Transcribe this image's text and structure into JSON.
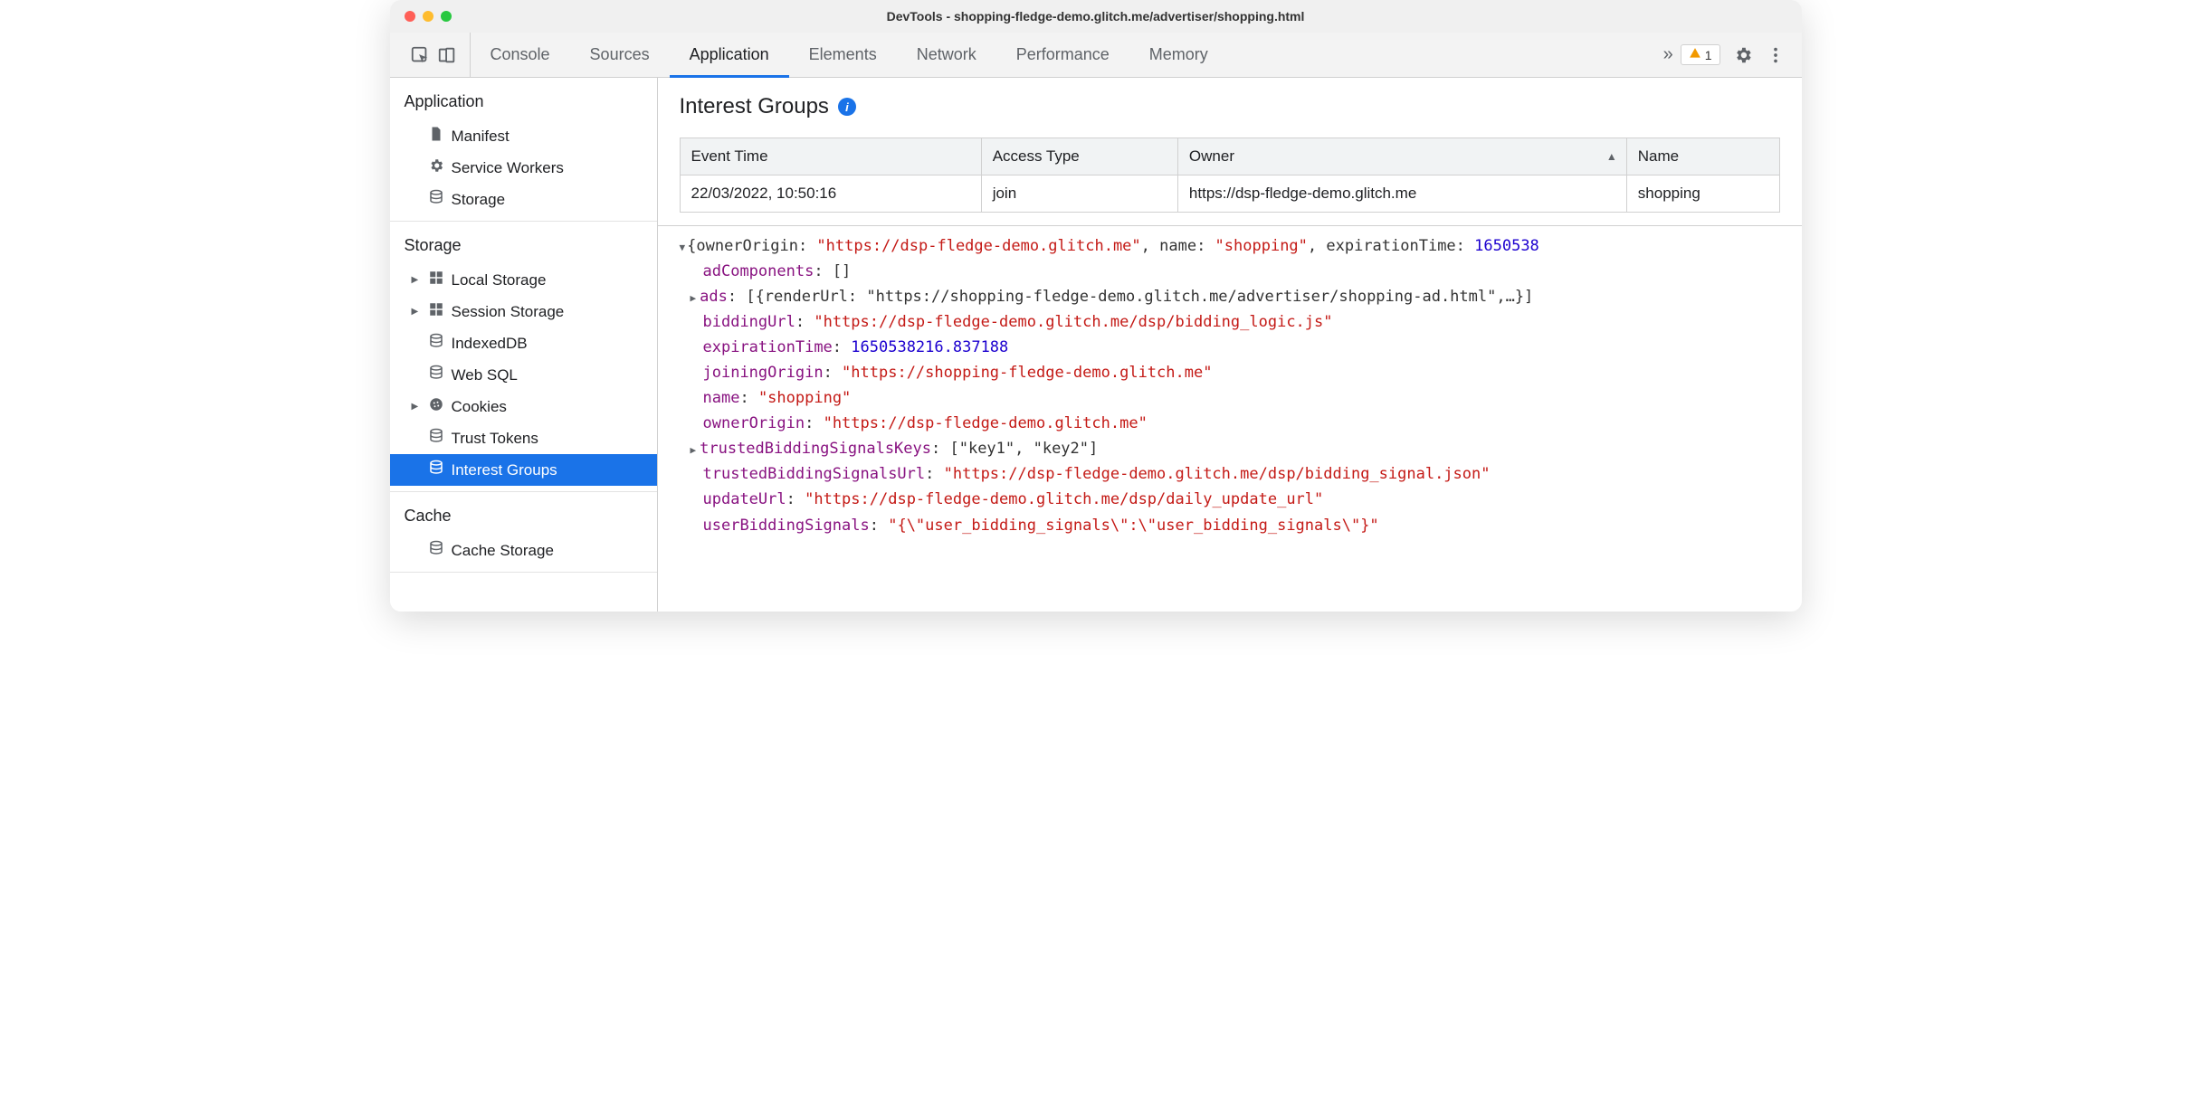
{
  "window": {
    "title": "DevTools - shopping-fledge-demo.glitch.me/advertiser/shopping.html"
  },
  "tabbar": {
    "tabs": [
      "Console",
      "Sources",
      "Application",
      "Elements",
      "Network",
      "Performance",
      "Memory"
    ],
    "active_index": 2,
    "warning_count": "1"
  },
  "sidebar": {
    "sections": [
      {
        "heading": "Application",
        "items": [
          {
            "label": "Manifest",
            "icon": "file-icon",
            "caret": false
          },
          {
            "label": "Service Workers",
            "icon": "gear-icon",
            "caret": false
          },
          {
            "label": "Storage",
            "icon": "database-icon",
            "caret": false
          }
        ]
      },
      {
        "heading": "Storage",
        "items": [
          {
            "label": "Local Storage",
            "icon": "grid-icon",
            "caret": true
          },
          {
            "label": "Session Storage",
            "icon": "grid-icon",
            "caret": true
          },
          {
            "label": "IndexedDB",
            "icon": "database-icon",
            "caret": false
          },
          {
            "label": "Web SQL",
            "icon": "database-icon",
            "caret": false
          },
          {
            "label": "Cookies",
            "icon": "cookie-icon",
            "caret": true
          },
          {
            "label": "Trust Tokens",
            "icon": "database-icon",
            "caret": false
          },
          {
            "label": "Interest Groups",
            "icon": "database-icon",
            "caret": false,
            "selected": true
          }
        ]
      },
      {
        "heading": "Cache",
        "items": [
          {
            "label": "Cache Storage",
            "icon": "database-icon",
            "caret": false
          }
        ]
      }
    ]
  },
  "panel": {
    "title": "Interest Groups",
    "table": {
      "columns": [
        "Event Time",
        "Access Type",
        "Owner",
        "Name"
      ],
      "sort_col": 2,
      "rows": [
        [
          "22/03/2022, 10:50:16",
          "join",
          "https://dsp-fledge-demo.glitch.me",
          "shopping"
        ]
      ]
    },
    "detail": {
      "summary_prefix": "{ownerOrigin: ",
      "summary_owner": "\"https://dsp-fledge-demo.glitch.me\"",
      "summary_mid": ", name: ",
      "summary_name": "\"shopping\"",
      "summary_mid2": ", expirationTime: ",
      "summary_exp": "1650538",
      "lines": [
        {
          "key": "adComponents",
          "val": "[]",
          "type": "punc"
        },
        {
          "key": "ads",
          "val": "[{renderUrl: \"https://shopping-fledge-demo.glitch.me/advertiser/shopping-ad.html\",…}]",
          "type": "punc",
          "caret": true
        },
        {
          "key": "biddingUrl",
          "val": "\"https://dsp-fledge-demo.glitch.me/dsp/bidding_logic.js\"",
          "type": "str"
        },
        {
          "key": "expirationTime",
          "val": "1650538216.837188",
          "type": "num"
        },
        {
          "key": "joiningOrigin",
          "val": "\"https://shopping-fledge-demo.glitch.me\"",
          "type": "str"
        },
        {
          "key": "name",
          "val": "\"shopping\"",
          "type": "str"
        },
        {
          "key": "ownerOrigin",
          "val": "\"https://dsp-fledge-demo.glitch.me\"",
          "type": "str"
        },
        {
          "key": "trustedBiddingSignalsKeys",
          "val": "[\"key1\", \"key2\"]",
          "type": "punc",
          "caret": true
        },
        {
          "key": "trustedBiddingSignalsUrl",
          "val": "\"https://dsp-fledge-demo.glitch.me/dsp/bidding_signal.json\"",
          "type": "str"
        },
        {
          "key": "updateUrl",
          "val": "\"https://dsp-fledge-demo.glitch.me/dsp/daily_update_url\"",
          "type": "str"
        },
        {
          "key": "userBiddingSignals",
          "val": "\"{\\\"user_bidding_signals\\\":\\\"user_bidding_signals\\\"}\"",
          "type": "str"
        }
      ]
    }
  }
}
